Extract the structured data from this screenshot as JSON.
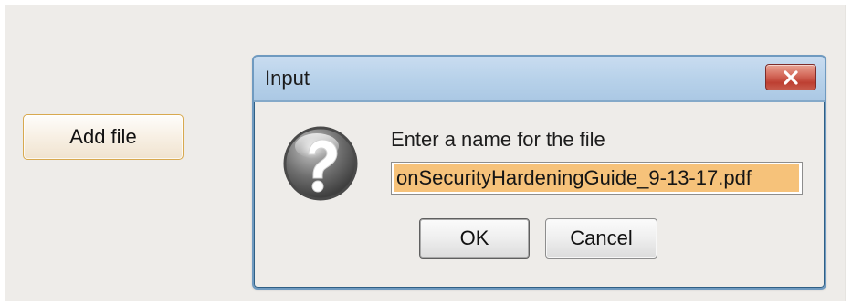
{
  "main": {
    "add_file_label": "Add file"
  },
  "dialog": {
    "title": "Input",
    "prompt": "Enter a name for the file",
    "filename_value": "onSecurityHardeningGuide_9-13-17.pdf",
    "ok_label": "OK",
    "cancel_label": "Cancel",
    "icons": {
      "close": "close-icon",
      "question": "question-icon"
    }
  },
  "colors": {
    "window_background": "#eeece9",
    "titlebar": "#b8d2ea",
    "selection_highlight": "#f6c27a",
    "close_button": "#c9483a",
    "add_button_border": "#d8a94f"
  }
}
